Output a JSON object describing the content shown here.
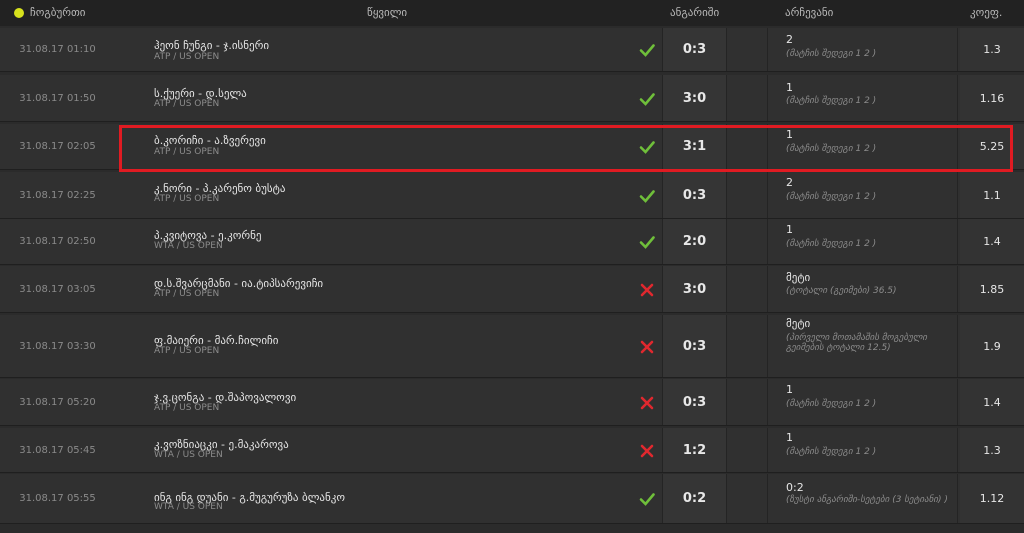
{
  "header": {
    "all_label": "ჩოგბურთი",
    "event_label": "წყვილი",
    "result_label": "ანგარიში",
    "choice_label": "არჩევანი",
    "coef_label": "კოეფ."
  },
  "rows": [
    {
      "date": "31.08.17 01:10",
      "title": "ჰეონ ჩუნგი - ჯ.ისნერი",
      "league": "ATP / US OPEN",
      "status": "win",
      "score": "0:3",
      "choice": "2",
      "choice_note": "(მატჩის შედეგი 1 2 )",
      "coef": "1.3"
    },
    {
      "date": "31.08.17 01:50",
      "title": "ს.ქუერი - დ.სელა",
      "league": "ATP / US OPEN",
      "status": "win",
      "score": "3:0",
      "choice": "1",
      "choice_note": "(მატჩის შედეგი 1 2 )",
      "coef": "1.16"
    },
    {
      "date": "31.08.17 02:05",
      "title": "ბ.კორიჩი - ა.ზვერევი",
      "league": "ATP / US OPEN",
      "status": "win",
      "score": "3:1",
      "choice": "1",
      "choice_note": "(მატჩის შედეგი 1 2 )",
      "coef": "5.25"
    },
    {
      "date": "31.08.17 02:25",
      "title": "კ.ნორი - პ.კარენო ბუსტა",
      "league": "ATP / US OPEN",
      "status": "win",
      "score": "0:3",
      "choice": "2",
      "choice_note": "(მატჩის შედეგი 1 2 )",
      "coef": "1.1"
    },
    {
      "date": "31.08.17 02:50",
      "title": "პ.კვიტოვა - ე.კორნე",
      "league": "WTA / US OPEN",
      "status": "win",
      "score": "2:0",
      "choice": "1",
      "choice_note": "(მატჩის შედეგი 1 2 )",
      "coef": "1.4"
    },
    {
      "date": "31.08.17 03:05",
      "title": "დ.ს.შვარცმანი - ია.ტიპსარევიჩი",
      "league": "ATP / US OPEN",
      "status": "loss",
      "score": "3:0",
      "choice": "მეტი",
      "choice_note": "(ტოტალი (გეიმები) 36.5)",
      "coef": "1.85"
    },
    {
      "date": "31.08.17 03:30",
      "title": "ფ.მაიერი - მარ.ჩილიჩი",
      "league": "ATP / US OPEN",
      "status": "loss",
      "score": "0:3",
      "choice": "მეტი",
      "choice_note": "(პირველი მოთამაშის მოგებული გეიმების ტოტალი 12.5)",
      "coef": "1.9"
    },
    {
      "date": "31.08.17 05:20",
      "title": "ჯ.ვ.ცონგა - დ.შაპოვალოვი",
      "league": "ATP / US OPEN",
      "status": "loss",
      "score": "0:3",
      "choice": "1",
      "choice_note": "(მატჩის შედეგი 1 2 )",
      "coef": "1.4"
    },
    {
      "date": "31.08.17 05:45",
      "title": "კ.ვოზნიაცკი - ე.მაკაროვა",
      "league": "WTA / US OPEN",
      "status": "loss",
      "score": "1:2",
      "choice": "1",
      "choice_note": "(მატჩის შედეგი 1 2 )",
      "coef": "1.3"
    },
    {
      "date": "31.08.17 05:55",
      "title": "ინგ ინგ დუანი - გ.მუგურუზა ბლანკო",
      "league": "WTA / US OPEN",
      "status": "win",
      "score": "0:2",
      "choice": "0:2",
      "choice_note": "(ზუსტი ანგარიში-სეტები (3 სეტიანი) )",
      "coef": "1.12"
    }
  ],
  "colors": {
    "win": "#6fbf3a",
    "loss": "#e0282e",
    "highlight": "#e01b22"
  }
}
